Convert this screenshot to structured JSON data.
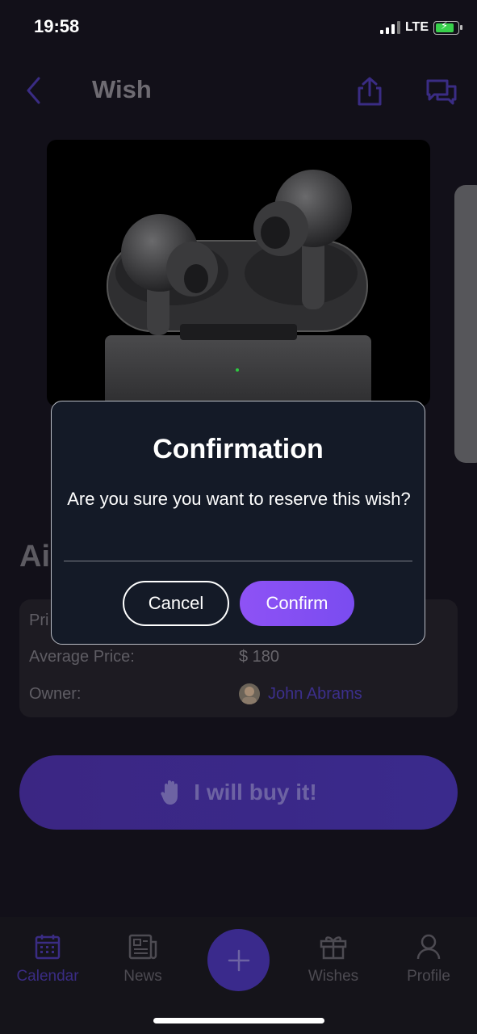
{
  "status_bar": {
    "time": "19:58",
    "network": "LTE"
  },
  "nav": {
    "title": "Wish"
  },
  "product": {
    "title_partial": "Ai"
  },
  "details": {
    "price_label_partial": "Pri",
    "average_price_label": "Average Price:",
    "average_price_value": "$ 180",
    "owner_label": "Owner:",
    "owner_name": "John Abrams"
  },
  "buy_button": {
    "label": "I will buy it!"
  },
  "tabs": [
    {
      "label": "Calendar",
      "icon": "calendar-icon",
      "active": true
    },
    {
      "label": "News",
      "icon": "newspaper-icon",
      "active": false
    },
    {
      "label": "Wishes",
      "icon": "gift-icon",
      "active": false
    },
    {
      "label": "Profile",
      "icon": "user-icon",
      "active": false
    }
  ],
  "modal": {
    "title": "Confirmation",
    "message": "Are you sure you want to reserve this wish?",
    "cancel_label": "Cancel",
    "confirm_label": "Confirm"
  },
  "colors": {
    "background": "#121019",
    "accent": "#8e52f5",
    "modal_background": "#141a27"
  }
}
